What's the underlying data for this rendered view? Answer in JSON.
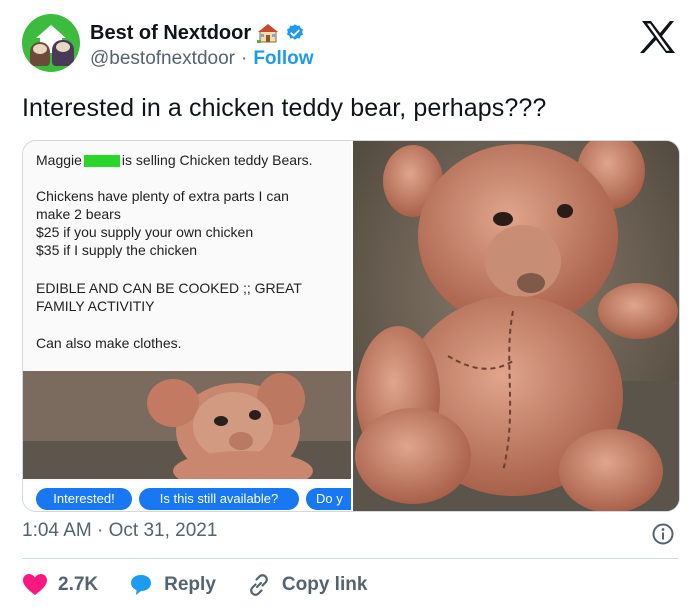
{
  "author": {
    "name": "Best of Nextdoor",
    "handle": "@bestofnextdoor",
    "separator": "·",
    "follow_label": "Follow"
  },
  "tweet": {
    "text": "Interested in a chicken teddy bear, perhaps???",
    "time": "1:04 AM",
    "dot": "·",
    "date": "Oct 31, 2021"
  },
  "embedded_post": {
    "seller_name": "Maggie",
    "seller_rest": "is selling Chicken teddy Bears.",
    "lines": [
      "Chickens have plenty of extra parts I can",
      "make 2 bears",
      "$25 if you supply your own chicken",
      "$35 if I supply the chicken"
    ],
    "caps_lines": [
      "EDIBLE AND CAN BE COOKED ;; GREAT",
      "FAMILY ACTIVITIY"
    ],
    "clothes_line": "Can also make clothes.",
    "buttons": [
      "Interested!",
      "Is this still available?",
      "Do y"
    ]
  },
  "actions": {
    "likes": "2.7K",
    "reply": "Reply",
    "copy_link": "Copy link"
  },
  "colors": {
    "link_blue": "#1d9bf0",
    "like_pink": "#f91880",
    "facebook_blue": "#1877f2",
    "redaction_green": "#2bd62b"
  },
  "icons": [
    "x-logo-icon",
    "verified-badge-icon",
    "house-emoji-icon",
    "info-icon",
    "heart-icon",
    "reply-bubble-icon",
    "link-icon"
  ]
}
